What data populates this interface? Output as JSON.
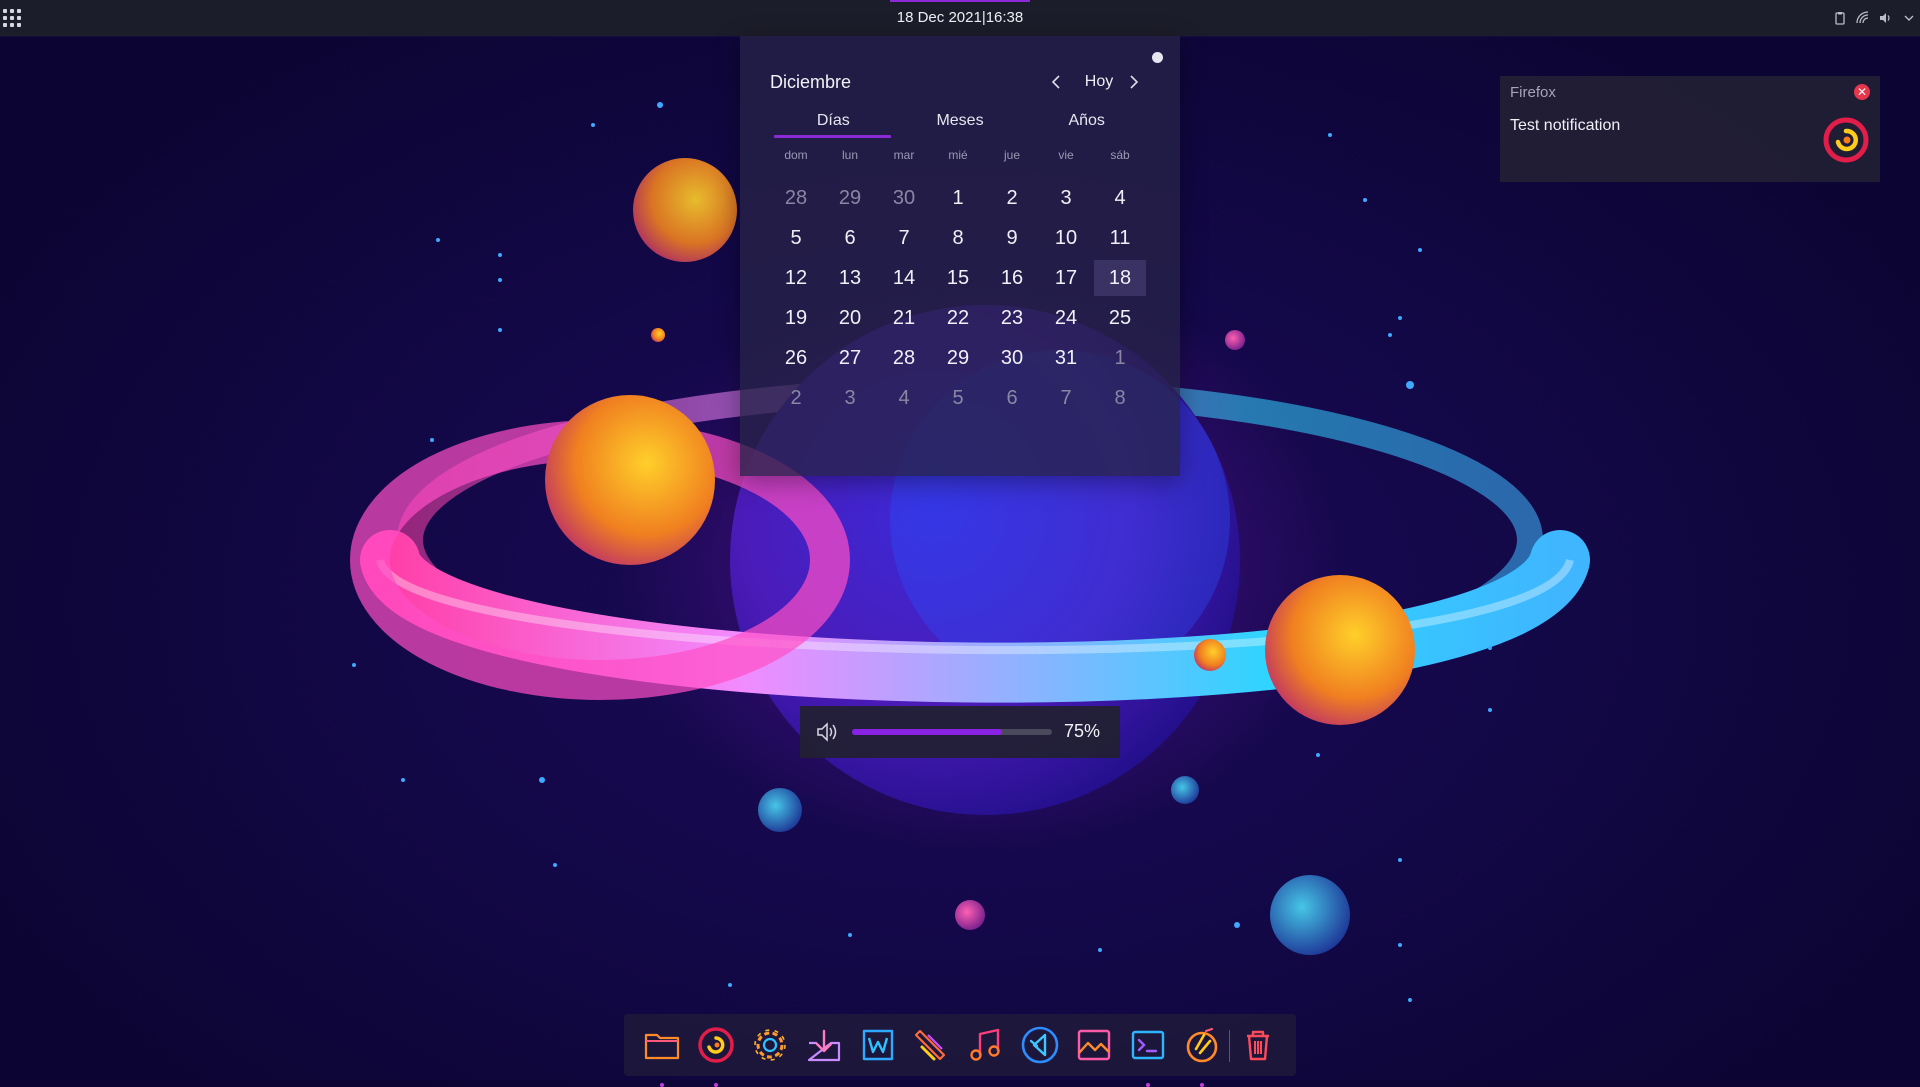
{
  "topbar": {
    "clock": "18 Dec 2021|16:38",
    "tray_icons": [
      "clipboard-icon",
      "network-icon",
      "volume-icon",
      "chevron-down-icon"
    ]
  },
  "calendar": {
    "month": "Diciembre",
    "today_label": "Hoy",
    "tabs": [
      "Días",
      "Meses",
      "Años"
    ],
    "active_tab": "Días",
    "weekdays": [
      "dom",
      "lun",
      "mar",
      "mié",
      "jue",
      "vie",
      "sáb"
    ],
    "days": [
      {
        "n": "28",
        "muted": true
      },
      {
        "n": "29",
        "muted": true
      },
      {
        "n": "30",
        "muted": true
      },
      {
        "n": "1"
      },
      {
        "n": "2"
      },
      {
        "n": "3"
      },
      {
        "n": "4"
      },
      {
        "n": "5"
      },
      {
        "n": "6"
      },
      {
        "n": "7"
      },
      {
        "n": "8"
      },
      {
        "n": "9"
      },
      {
        "n": "10"
      },
      {
        "n": "11"
      },
      {
        "n": "12"
      },
      {
        "n": "13"
      },
      {
        "n": "14"
      },
      {
        "n": "15"
      },
      {
        "n": "16"
      },
      {
        "n": "17"
      },
      {
        "n": "18",
        "today": true
      },
      {
        "n": "19"
      },
      {
        "n": "20"
      },
      {
        "n": "21"
      },
      {
        "n": "22"
      },
      {
        "n": "23"
      },
      {
        "n": "24"
      },
      {
        "n": "25"
      },
      {
        "n": "26"
      },
      {
        "n": "27"
      },
      {
        "n": "28"
      },
      {
        "n": "29"
      },
      {
        "n": "30"
      },
      {
        "n": "31"
      },
      {
        "n": "1",
        "muted": true
      },
      {
        "n": "2",
        "muted": true
      },
      {
        "n": "3",
        "muted": true
      },
      {
        "n": "4",
        "muted": true
      },
      {
        "n": "5",
        "muted": true
      },
      {
        "n": "6",
        "muted": true
      },
      {
        "n": "7",
        "muted": true
      },
      {
        "n": "8",
        "muted": true
      }
    ]
  },
  "notification": {
    "app": "Firefox",
    "text": "Test notification"
  },
  "volume": {
    "label": "75%",
    "level": 0.75
  },
  "dock": {
    "items": [
      {
        "name": "file-manager",
        "icon": "folder-icon",
        "running": true
      },
      {
        "name": "browser",
        "icon": "browser-icon",
        "running": true
      },
      {
        "name": "settings",
        "icon": "gear-icon",
        "running": false
      },
      {
        "name": "app-installer",
        "icon": "package-icon",
        "running": false
      },
      {
        "name": "word-processor",
        "icon": "document-w-icon",
        "running": false
      },
      {
        "name": "paint",
        "icon": "brush-icon",
        "running": false
      },
      {
        "name": "music",
        "icon": "music-note-icon",
        "running": false
      },
      {
        "name": "code-editor",
        "icon": "code-editor-icon",
        "running": false
      },
      {
        "name": "image-viewer",
        "icon": "image-icon",
        "running": false
      },
      {
        "name": "terminal",
        "icon": "terminal-icon",
        "running": true
      },
      {
        "name": "cleaner",
        "icon": "cleaner-icon",
        "running": true
      }
    ],
    "trash": {
      "name": "trash",
      "icon": "trash-icon"
    }
  },
  "colors": {
    "accent": "#8b2bd6",
    "close_red": "#e5364c",
    "volume_fill": "#8a22e6"
  }
}
